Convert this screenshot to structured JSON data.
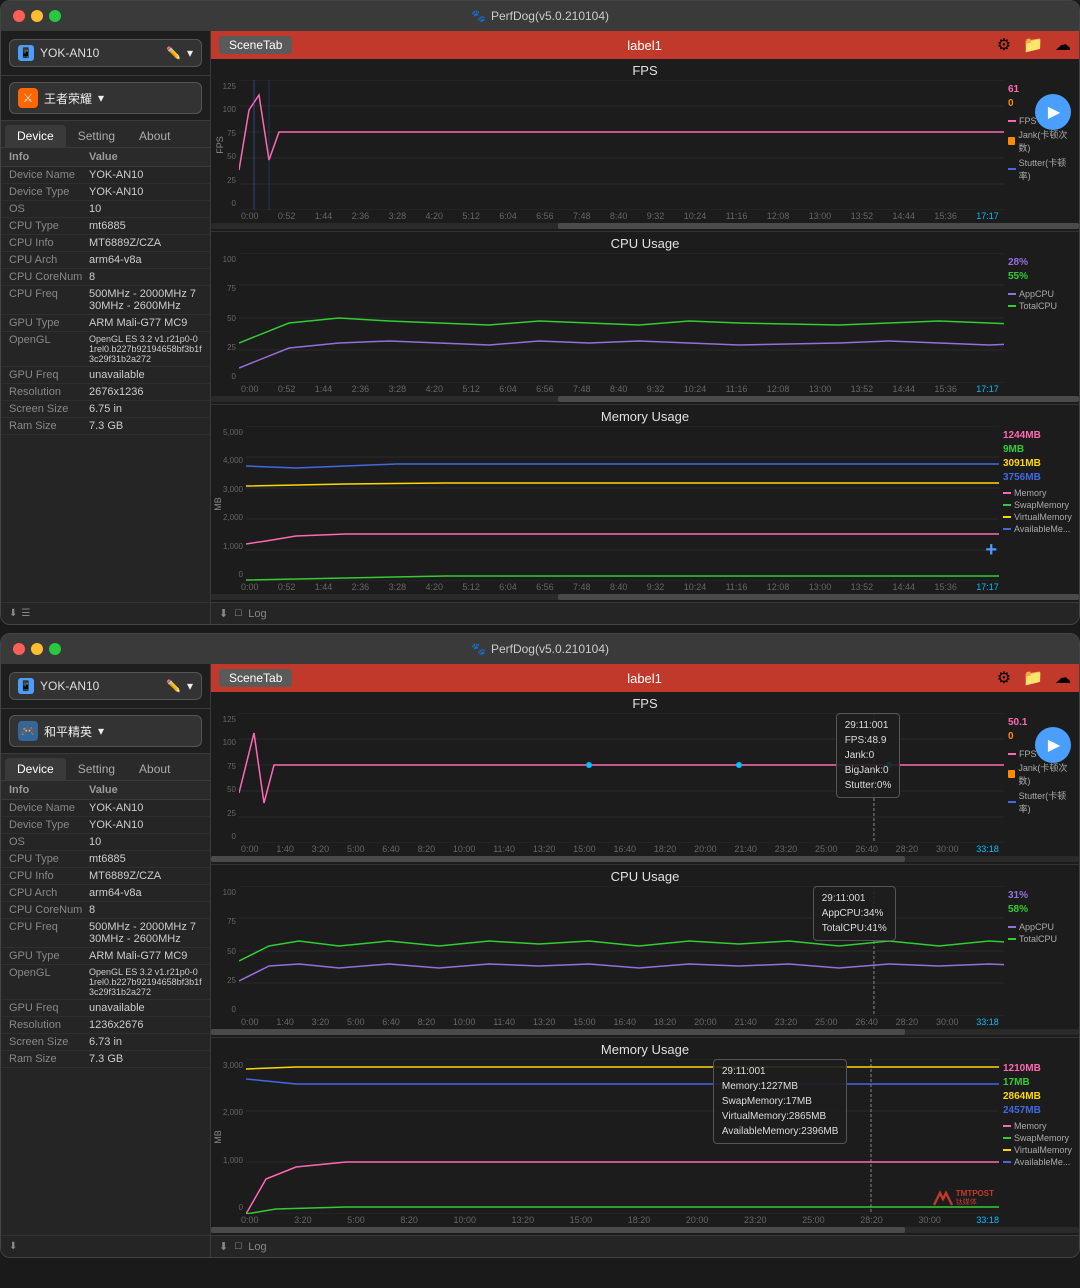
{
  "windows": [
    {
      "id": "window1",
      "title": "PerfDog(v5.0.210104)",
      "device": "YOK-AN10",
      "app": "王者荣耀",
      "app_color": "#ff6600",
      "tabs": [
        "Device",
        "Setting",
        "About"
      ],
      "active_tab": "Device",
      "scene_tab": "SceneTab",
      "label": "label1",
      "info_headers": [
        "Info",
        "Value"
      ],
      "info_rows": [
        [
          "Device Name",
          "YOK-AN10"
        ],
        [
          "Device Type",
          "YOK-AN10"
        ],
        [
          "OS",
          "10"
        ],
        [
          "CPU Type",
          "mt6885"
        ],
        [
          "CPU Info",
          "MT6889Z/CZA"
        ],
        [
          "CPU Arch",
          "arm64-v8a"
        ],
        [
          "CPU CoreNum",
          "8"
        ],
        [
          "CPU Freq",
          "500MHz -\n2000MHz\n730MHz -\n2600MHz"
        ],
        [
          "GPU Type",
          "ARM Mali-G77\nMC9"
        ],
        [
          "OpenGL",
          "OpenGL ES 3.2\nv1.r21p0-01rel0.b\n227b92194658bf3\nb1f3c29f31b2a27\n2"
        ],
        [
          "GPU Freq",
          "unavailable"
        ],
        [
          "Resolution",
          "2676x1236"
        ],
        [
          "Screen Size",
          "6.75 in"
        ],
        [
          "Ram Size",
          "7.3 GB"
        ]
      ],
      "charts": [
        {
          "title": "FPS",
          "y_label": "FPS",
          "y_max": 125,
          "y_ticks": [
            125,
            100,
            75,
            50,
            25,
            0
          ],
          "value_labels": [
            {
              "text": "61",
              "color": "#ff69b4"
            },
            {
              "text": "0",
              "color": "#ff8c00"
            }
          ],
          "legend": [
            {
              "label": "FPS",
              "color": "#ff69b4"
            },
            {
              "label": "Jank(卡顿次数)",
              "color": "#ff8c00"
            },
            {
              "label": "Stutter(卡顿率)",
              "color": "#4169e1"
            }
          ],
          "time_labels": [
            "0:00",
            "0:52",
            "1:44",
            "2:36",
            "3:28",
            "4:20",
            "5:12",
            "6:04",
            "6:56",
            "7:48",
            "8:40",
            "9:32",
            "10:24",
            "11:16",
            "12:08",
            "13:00",
            "13:52",
            "14:44",
            "15:36",
            "17:17"
          ],
          "height": 130
        },
        {
          "title": "CPU Usage",
          "y_label": "%",
          "y_max": 100,
          "y_ticks": [
            100,
            75,
            50,
            25,
            0
          ],
          "value_labels": [
            {
              "text": "28%",
              "color": "#9370db"
            },
            {
              "text": "55%",
              "color": "#32cd32"
            }
          ],
          "legend": [
            {
              "label": "AppCPU",
              "color": "#9370db"
            },
            {
              "label": "TotalCPU",
              "color": "#32cd32"
            }
          ],
          "time_labels": [
            "0:00",
            "0:52",
            "1:44",
            "2:36",
            "3:28",
            "4:20",
            "5:12",
            "6:04",
            "6:56",
            "7:48",
            "8:40",
            "9:32",
            "10:24",
            "11:16",
            "12:08",
            "13:00",
            "13:52",
            "14:44",
            "15:36",
            "17:17"
          ],
          "height": 130
        },
        {
          "title": "Memory Usage",
          "y_label": "MB",
          "y_max": 5000,
          "y_ticks": [
            5000,
            4000,
            3000,
            2000,
            1000,
            0
          ],
          "value_labels": [
            {
              "text": "1244MB",
              "color": "#ff69b4"
            },
            {
              "text": "9MB",
              "color": "#32cd32"
            },
            {
              "text": "3091MB",
              "color": "#ffd700"
            },
            {
              "text": "3756MB",
              "color": "#4169e1"
            }
          ],
          "legend": [
            {
              "label": "Memory",
              "color": "#ff69b4"
            },
            {
              "label": "SwapMemory",
              "color": "#32cd32"
            },
            {
              "label": "VirtualMemory",
              "color": "#ffd700"
            },
            {
              "label": "AvailableMe...",
              "color": "#4169e1"
            }
          ],
          "time_labels": [
            "0:00",
            "0:52",
            "1:44",
            "2:36",
            "3:28",
            "4:20",
            "5:12",
            "6:04",
            "6:56",
            "7:48",
            "8:40",
            "9:32",
            "10:24",
            "11:16",
            "12:08",
            "13:00",
            "13:52",
            "14:44",
            "15:36",
            "17:17"
          ],
          "height": 160
        }
      ]
    },
    {
      "id": "window2",
      "title": "PerfDog(v5.0.210104)",
      "device": "YOK-AN10",
      "app": "和平精英",
      "app_color": "#336699",
      "tabs": [
        "Device",
        "Setting",
        "About"
      ],
      "active_tab": "Device",
      "scene_tab": "SceneTab",
      "label": "label1",
      "info_headers": [
        "Info",
        "Value"
      ],
      "info_rows": [
        [
          "Device Name",
          "YOK-AN10"
        ],
        [
          "Device Type",
          "YOK-AN10"
        ],
        [
          "OS",
          "10"
        ],
        [
          "CPU Type",
          "mt6885"
        ],
        [
          "CPU Info",
          "MT6889Z/CZA"
        ],
        [
          "CPU Arch",
          "arm64-v8a"
        ],
        [
          "CPU CoreNum",
          "8"
        ],
        [
          "CPU Freq",
          "500MHz -\n2000MHz\n730MHz -\n2600MHz"
        ],
        [
          "GPU Type",
          "ARM Mali-G77\nMC9"
        ],
        [
          "OpenGL",
          "OpenGL ES 3.2\nv1.r21p0-01rel0.b\n227b92194658bf3\nb1f3c29f31b2a27\n2"
        ],
        [
          "GPU Freq",
          "unavailable"
        ],
        [
          "Resolution",
          "1236x2676"
        ],
        [
          "Screen Size",
          "6.73 in"
        ],
        [
          "Ram Size",
          "7.3 GB"
        ]
      ],
      "charts": [
        {
          "title": "FPS",
          "y_label": "FPS",
          "y_max": 125,
          "y_ticks": [
            125,
            100,
            75,
            50,
            25,
            0
          ],
          "value_labels": [
            {
              "text": "50.1",
              "color": "#ff69b4"
            },
            {
              "text": "0",
              "color": "#ff8c00"
            }
          ],
          "tooltip": "29:11:001\nFPS:48.9\nJank:0\nBigJank:0\nStutter:0%",
          "legend": [
            {
              "label": "FPS",
              "color": "#ff69b4"
            },
            {
              "label": "Jank(卡顿次数)",
              "color": "#ff8c00"
            },
            {
              "label": "Stutter(卡顿率)",
              "color": "#4169e1"
            }
          ],
          "time_labels": [
            "0:00",
            "1:40",
            "3:20",
            "5:00",
            "6:40",
            "8:20",
            "10:00",
            "11:40",
            "13:20",
            "15:00",
            "16:40",
            "18:20",
            "20:00",
            "21:40",
            "23:20",
            "25:00",
            "26:40",
            "28:20",
            "30:00",
            "33:18"
          ],
          "height": 130
        },
        {
          "title": "CPU Usage",
          "y_label": "%",
          "y_max": 100,
          "y_ticks": [
            100,
            75,
            50,
            25,
            0
          ],
          "value_labels": [
            {
              "text": "31%",
              "color": "#9370db"
            },
            {
              "text": "58%",
              "color": "#32cd32"
            }
          ],
          "tooltip": "29:11:001\nAppCPU:34%\nTotalCPU:41%",
          "legend": [
            {
              "label": "AppCPU",
              "color": "#9370db"
            },
            {
              "label": "TotalCPU",
              "color": "#32cd32"
            }
          ],
          "time_labels": [
            "0:00",
            "1:40",
            "3:20",
            "5:00",
            "6:40",
            "8:20",
            "10:00",
            "11:40",
            "13:20",
            "15:00",
            "16:40",
            "18:20",
            "20:00",
            "21:40",
            "23:20",
            "25:00",
            "26:40",
            "28:20",
            "30:00",
            "33:18"
          ],
          "height": 130
        },
        {
          "title": "Memory Usage",
          "y_label": "MB",
          "y_max": 3000,
          "y_ticks": [
            3000,
            2000,
            1000,
            0
          ],
          "value_labels": [
            {
              "text": "1210MB",
              "color": "#ff69b4"
            },
            {
              "text": "17MB",
              "color": "#32cd32"
            },
            {
              "text": "2864MB",
              "color": "#ffd700"
            },
            {
              "text": "2457MB",
              "color": "#4169e1"
            }
          ],
          "tooltip": "29:11:001\nMemory:1227MB\nSwapMemory:17MB\nVirtualMemory:2865MB\nAvailableMemory:2396MB",
          "legend": [
            {
              "label": "Memory",
              "color": "#ff69b4"
            },
            {
              "label": "SwapMemory",
              "color": "#32cd32"
            },
            {
              "label": "VirtualMemory",
              "color": "#ffd700"
            },
            {
              "label": "AvailableMe...",
              "color": "#4169e1"
            }
          ],
          "time_labels": [
            "0:00",
            "3:20",
            "5:00",
            "8:20",
            "10:00",
            "13:20",
            "15:00",
            "18:20",
            "20:00",
            "23:20",
            "25:00",
            "28:20",
            "30:00",
            "33:18"
          ],
          "height": 160
        }
      ]
    }
  ],
  "bottom_bar": {
    "log_label": "Log"
  }
}
